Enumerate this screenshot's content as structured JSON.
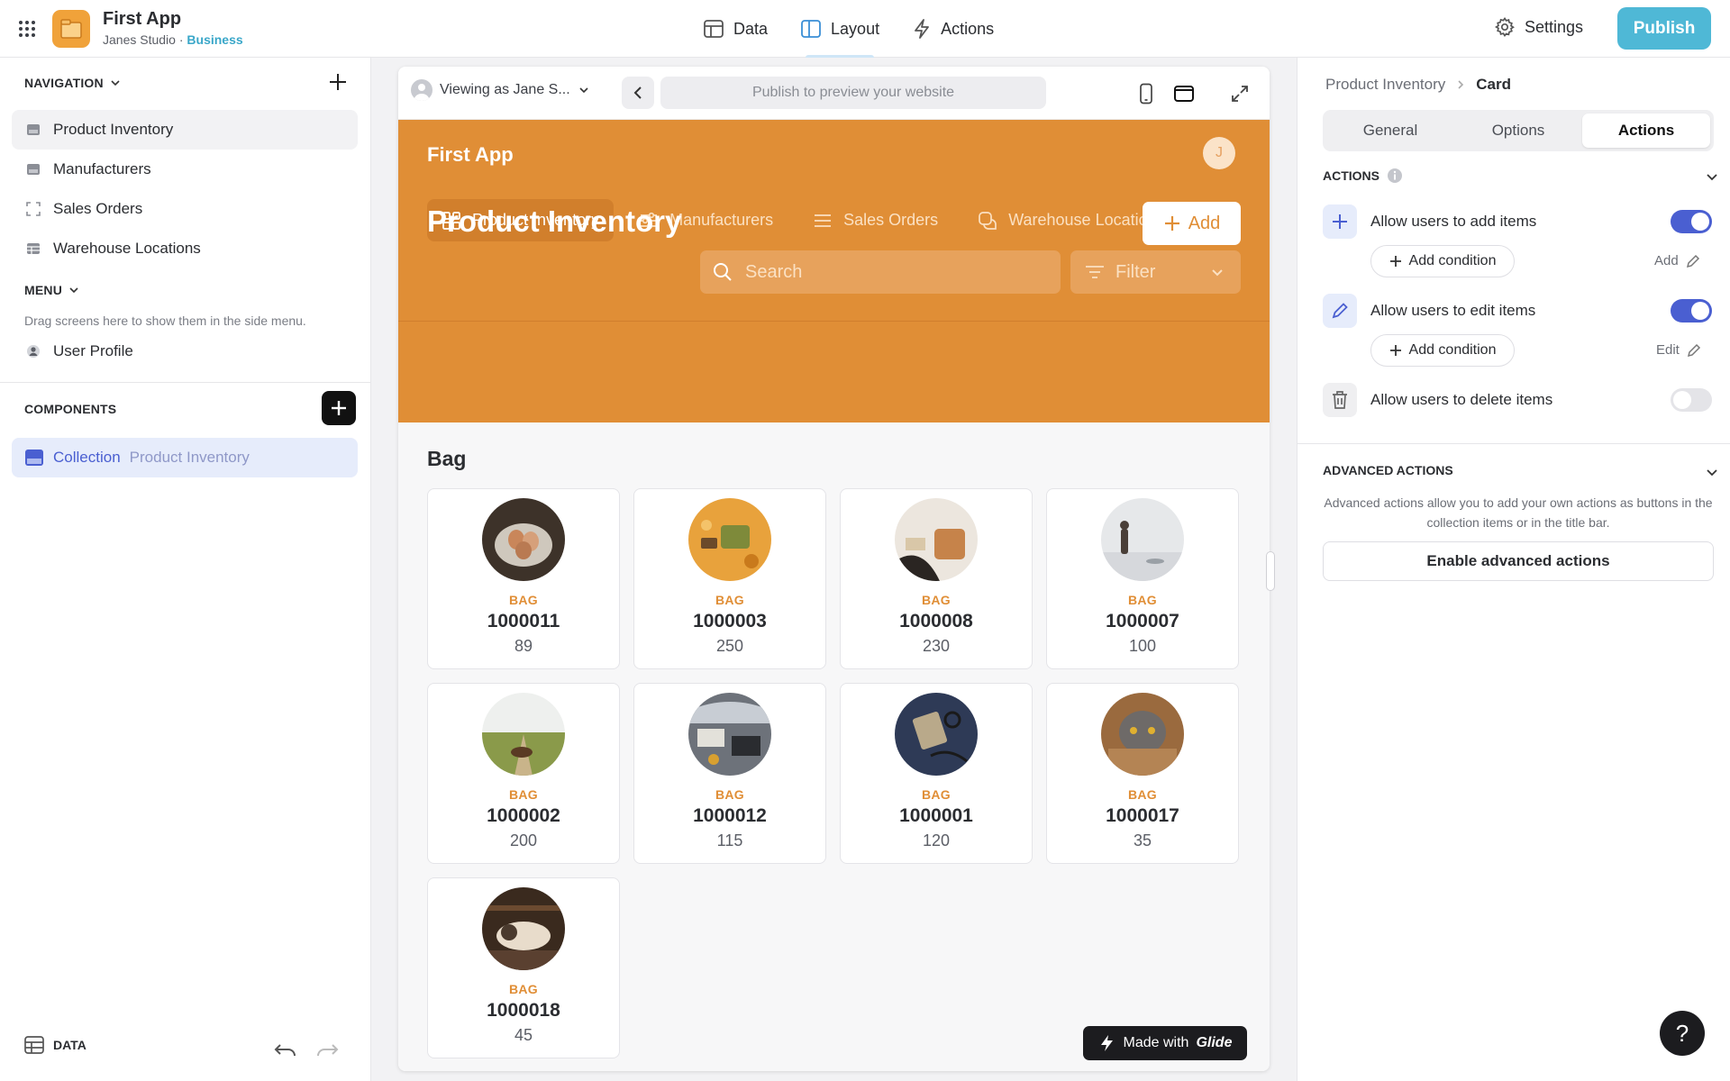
{
  "app": {
    "title": "First App",
    "workspace": "Janes Studio",
    "separator": " · ",
    "plan": "Business"
  },
  "topnav": {
    "items": [
      {
        "label": "Data"
      },
      {
        "label": "Layout"
      },
      {
        "label": "Actions"
      }
    ],
    "active": "Layout"
  },
  "header_right": {
    "settings_label": "Settings",
    "publish_label": "Publish"
  },
  "left_panel": {
    "navigation_header": "NAVIGATION",
    "navigation_items": [
      {
        "label": "Product Inventory",
        "icon": "table-icon",
        "selected": true
      },
      {
        "label": "Manufacturers",
        "icon": "table-icon"
      },
      {
        "label": "Sales Orders",
        "icon": "frame-icon"
      },
      {
        "label": "Warehouse Locations",
        "icon": "list-table-icon"
      }
    ],
    "menu_header": "MENU",
    "menu_hint": "Drag screens here to show them in the side menu.",
    "menu_items": [
      {
        "label": "User Profile",
        "icon": "user-icon"
      }
    ],
    "components_header": "COMPONENTS",
    "component": {
      "type": "Collection",
      "source": "Product Inventory"
    },
    "data_label": "DATA"
  },
  "preview_bar": {
    "viewing_as": "Viewing as Jane S...",
    "url_placeholder": "Publish to preview your website"
  },
  "preview_app": {
    "title": "First App",
    "avatar_initial": "J",
    "tabs": [
      {
        "label": "Product Inventory",
        "icon": "grid-icon",
        "active": true
      },
      {
        "label": "Manufacturers",
        "icon": "sliders-icon"
      },
      {
        "label": "Sales Orders",
        "icon": "menu-icon"
      },
      {
        "label": "Warehouse Locations",
        "icon": "chat-icon"
      }
    ],
    "page_title": "Product Inventory",
    "add_label": "Add",
    "search_placeholder": "Search",
    "filter_label": "Filter",
    "group_title": "Bag",
    "items": [
      {
        "category": "BAG",
        "id": "1000011",
        "value": "89",
        "thumb": "eggs"
      },
      {
        "category": "BAG",
        "id": "1000003",
        "value": "250",
        "thumb": "leaves-bag"
      },
      {
        "category": "BAG",
        "id": "1000008",
        "value": "230",
        "thumb": "leather-bag"
      },
      {
        "category": "BAG",
        "id": "1000007",
        "value": "100",
        "thumb": "fog-person"
      },
      {
        "category": "BAG",
        "id": "1000002",
        "value": "200",
        "thumb": "field-road"
      },
      {
        "category": "BAG",
        "id": "1000012",
        "value": "115",
        "thumb": "car-trunk"
      },
      {
        "category": "BAG",
        "id": "1000001",
        "value": "120",
        "thumb": "navy-items"
      },
      {
        "category": "BAG",
        "id": "1000017",
        "value": "35",
        "thumb": "cat-box"
      },
      {
        "category": "BAG",
        "id": "1000018",
        "value": "45",
        "thumb": "cat-bed"
      }
    ],
    "made_with_prefix": "Made with",
    "made_with_brand": "Glide"
  },
  "right_panel": {
    "breadcrumb": [
      "Product Inventory",
      "Card"
    ],
    "tabs": [
      "General",
      "Options",
      "Actions"
    ],
    "active_tab": "Actions",
    "actions_header": "ACTIONS",
    "actions": [
      {
        "label": "Allow users to add items",
        "enabled": true,
        "condition_label": "Add condition",
        "link_label": "Add"
      },
      {
        "label": "Allow users to edit items",
        "enabled": true,
        "condition_label": "Add condition",
        "link_label": "Edit"
      },
      {
        "label": "Allow users to delete items",
        "enabled": false
      }
    ],
    "advanced_header": "ADVANCED ACTIONS",
    "advanced_desc": "Advanced actions allow you to add your own actions as buttons in the collection items or in the title bar.",
    "advanced_button": "Enable advanced actions"
  },
  "help_label": "?",
  "colors": {
    "brand_orange": "#e08e36",
    "accent_blue": "#4a5fd1",
    "publish_blue": "#4fb8d6"
  }
}
